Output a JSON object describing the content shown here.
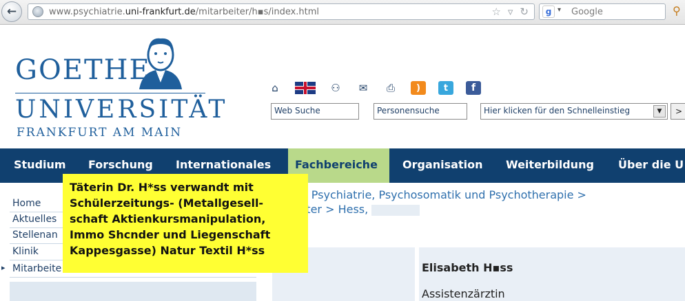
{
  "browser": {
    "url_prefix": "www.psychiatrie.",
    "url_host": "uni-frankfurt.de",
    "url_suffix": "/mitarbeiter/h▪s/index.html",
    "search_engine": "Google",
    "back_glyph": "←"
  },
  "logo": {
    "line1": "GOETHE",
    "line2": "UNIVERSITÄT",
    "line3": "FRANKFURT AM MAIN"
  },
  "utility_icons": [
    "home-icon",
    "uk-flag-icon",
    "sitemap-icon",
    "mail-icon",
    "print-icon",
    "rss-icon",
    "twitter-icon",
    "facebook-icon"
  ],
  "header": {
    "web_search": "Web Suche",
    "person_search": "Personensuche",
    "quick_entry": "Hier klicken für den Schnelleinstieg",
    "go_glyph": ">"
  },
  "nav": {
    "items": [
      "Studium",
      "Forschung",
      "Internationales",
      "Fachbereiche",
      "Organisation",
      "Weiterbildung",
      "Über die U"
    ],
    "active_index": 3,
    "bar_color": "#10406f",
    "active_color": "#b9d98a"
  },
  "sidebar": {
    "items": [
      "Home",
      "Aktuelles",
      "Stellenan",
      "Klinik",
      "Mitarbeite"
    ],
    "active_index": 4
  },
  "breadcrumb": {
    "line1": "ür Psychiatrie, Psychosomatik und Psychotherapie  >",
    "line2": "eiter  >  Hess,"
  },
  "profile": {
    "name": "Elisabeth H▪ss",
    "role": "Assistenzärztin"
  },
  "overlay": {
    "lines": [
      "Täterin Dr. H*ss verwandt mit",
      "Schülerzeitungs- (Metallgesell-",
      "schaft Aktienkursmanipulation,",
      "Immo Shcnder und Liegenschaft",
      "Kappesgasse) Natur Textil H*ss"
    ],
    "background": "#ffff33"
  }
}
